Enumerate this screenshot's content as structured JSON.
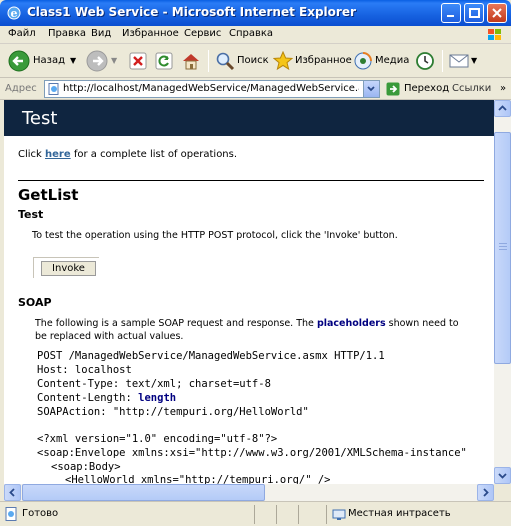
{
  "window": {
    "title": "Class1 Web Service - Microsoft Internet Explorer"
  },
  "menu": {
    "items": [
      "Файл",
      "Правка",
      "Вид",
      "Избранное",
      "Сервис",
      "Справка"
    ]
  },
  "toolbar": {
    "back_label": "Назад",
    "search_label": "Поиск",
    "favorites_label": "Избранное",
    "media_label": "Медиа"
  },
  "address": {
    "label": "Адрес",
    "url": "http://localhost/ManagedWebService/ManagedWebService.asmx?op=Hel",
    "go_label": "Переход",
    "links_label": "Ссылки"
  },
  "page": {
    "banner_title": "Test",
    "intro_prefix": "Click",
    "intro_link": "here",
    "intro_suffix": "for a complete list of operations.",
    "operation_name": "GetList",
    "test_heading": "Test",
    "test_text": "To test the operation using the HTTP POST protocol, click the 'Invoke' button.",
    "invoke_label": "Invoke",
    "soap_heading": "SOAP",
    "soap_text_1_prefix": "The following is a sample SOAP request and response. The",
    "soap_text_1_link": "placeholders",
    "soap_text_1_suffix": "shown need to",
    "soap_text_2": "be replaced with actual values.",
    "code": {
      "line1": "POST /ManagedWebService/ManagedWebService.asmx HTTP/1.1",
      "line2": "Host: localhost",
      "line3": "Content-Type: text/xml; charset=utf-8",
      "line4_prefix": "Content-Length:",
      "line4_value": "length",
      "line5": "SOAPAction: \"http://tempuri.org/HelloWorld\"",
      "line6": "<?xml version=\"1.0\" encoding=\"utf-8\"?>",
      "line7": "<soap:Envelope xmlns:xsi=\"http://www.w3.org/2001/XMLSchema-instance\"",
      "line8": "<soap:Body>",
      "line9": "<HelloWorld xmlns=\"http://tempuri.org/\" />"
    }
  },
  "status": {
    "text": "Готово",
    "zone": "Местная интрасеть"
  }
}
